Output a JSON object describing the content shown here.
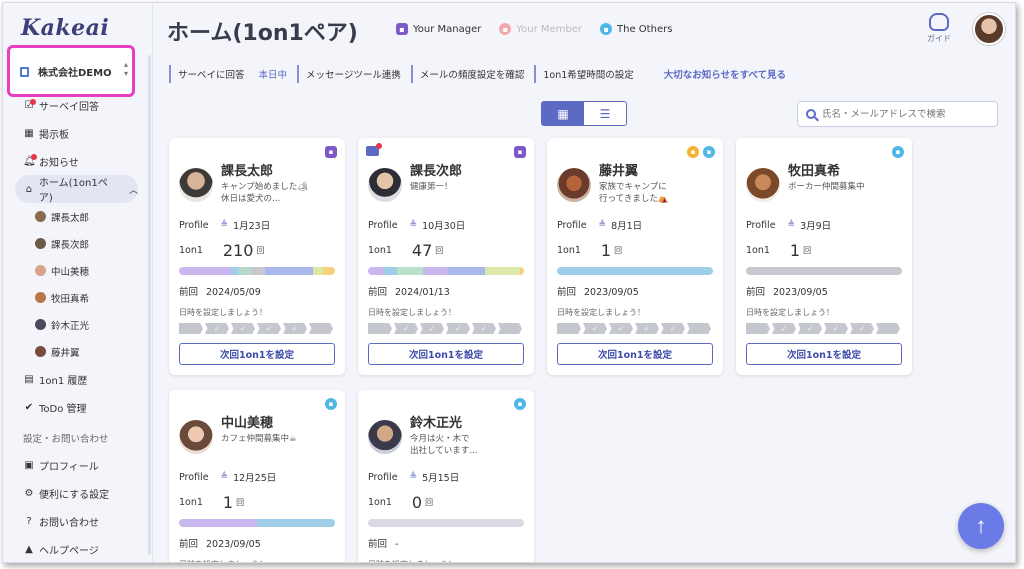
{
  "app": {
    "logo": "Kakeai",
    "company": "株式会社DEMO"
  },
  "sidebar": {
    "items": [
      {
        "label": "サーベイ回答"
      },
      {
        "label": "掲示板"
      },
      {
        "label": "お知らせ"
      },
      {
        "label": "ホーム(1on1ペア)"
      }
    ],
    "sub_items": [
      {
        "label": "課長太郎"
      },
      {
        "label": "課長次郎"
      },
      {
        "label": "中山美穂"
      },
      {
        "label": "牧田真希"
      },
      {
        "label": "鈴木正光"
      },
      {
        "label": "藤井翼"
      }
    ],
    "items2": [
      {
        "label": "1on1 履歴"
      },
      {
        "label": "ToDo 管理"
      }
    ],
    "section_label": "設定・お問い合わせ",
    "settings": [
      {
        "label": "プロフィール"
      },
      {
        "label": "便利にする設定"
      },
      {
        "label": "お問い合わせ"
      },
      {
        "label": "ヘルプページ"
      }
    ]
  },
  "header": {
    "title": "ホーム(1on1ペア)",
    "filters": [
      {
        "label": "Your Manager",
        "color": "#7b5ac7"
      },
      {
        "label": "Your Member",
        "color": "#f2a8ad"
      },
      {
        "label": "The Others",
        "color": "#4fb8e6"
      }
    ],
    "guide_label": "ガイド"
  },
  "links": {
    "survey": "サーベイに回答",
    "survey_status": "本日中",
    "message_tool": "メッセージツール連携",
    "frequency": "メールの頻度設定を確認",
    "hope_time": "1on1希望時間の設定",
    "all_notices": "大切なお知らせをすべて見る"
  },
  "search": {
    "placeholder": "氏名・メールアドレスで検索"
  },
  "labels": {
    "profile": "Profile",
    "oneonone": "1on1",
    "last": "前回",
    "unit": "回",
    "hint": "日時を設定しましょう！",
    "set_button": "次回1on1を設定"
  },
  "cards": [
    {
      "name": "課長太郎",
      "status1": "キャンプ始めました🏕",
      "status2": "休日は愛犬の…",
      "birthday": "1月23日",
      "count": "210",
      "last": "2024/05/09"
    },
    {
      "name": "課長次郎",
      "status1": "健康第一！",
      "status2": "",
      "birthday": "10月30日",
      "count": "47",
      "last": "2024/01/13"
    },
    {
      "name": "藤井翼",
      "status1": "家族でキャンプに",
      "status2": "行ってきました⛺",
      "birthday": "8月1日",
      "count": "1",
      "last": "2023/09/05"
    },
    {
      "name": "牧田真希",
      "status1": "ボーカー仲間募集中",
      "status2": "",
      "birthday": "3月9日",
      "count": "1",
      "last": "2023/09/05"
    },
    {
      "name": "中山美穂",
      "status1": "カフェ仲間募集中☕",
      "status2": "",
      "birthday": "12月25日",
      "count": "1",
      "last": "2023/09/05"
    },
    {
      "name": "鈴木正光",
      "status1": "今月は火・木で",
      "status2": "出社しています…",
      "birthday": "5月15日",
      "count": "0",
      "last": "-"
    }
  ]
}
